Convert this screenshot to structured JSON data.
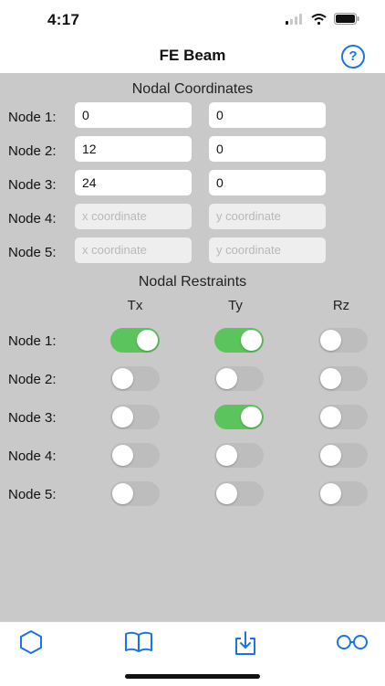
{
  "status": {
    "time": "4:17"
  },
  "nav": {
    "title": "FE Beam",
    "help": "?"
  },
  "coordinates": {
    "title": "Nodal Coordinates",
    "rows": [
      {
        "label": "Node 1:",
        "x": "0",
        "y": "0",
        "x_placeholder": "",
        "y_placeholder": ""
      },
      {
        "label": "Node 2:",
        "x": "12",
        "y": "0",
        "x_placeholder": "",
        "y_placeholder": ""
      },
      {
        "label": "Node 3:",
        "x": "24",
        "y": "0",
        "x_placeholder": "",
        "y_placeholder": ""
      },
      {
        "label": "Node 4:",
        "x": "",
        "y": "",
        "x_placeholder": "x coordinate",
        "y_placeholder": "y coordinate"
      },
      {
        "label": "Node 5:",
        "x": "",
        "y": "",
        "x_placeholder": "x coordinate",
        "y_placeholder": "y coordinate"
      }
    ]
  },
  "restraints": {
    "title": "Nodal Restraints",
    "headers": [
      "Tx",
      "Ty",
      "Rz"
    ],
    "rows": [
      {
        "label": "Node 1:",
        "tx": true,
        "ty": true,
        "rz": false
      },
      {
        "label": "Node 2:",
        "tx": false,
        "ty": false,
        "rz": false
      },
      {
        "label": "Node 3:",
        "tx": false,
        "ty": true,
        "rz": false
      },
      {
        "label": "Node 4:",
        "tx": false,
        "ty": false,
        "rz": false
      },
      {
        "label": "Node 5:",
        "tx": false,
        "ty": false,
        "rz": false
      }
    ]
  },
  "tabs": [
    {
      "icon": "hexagon-icon"
    },
    {
      "icon": "book-icon"
    },
    {
      "icon": "download-tray-icon"
    },
    {
      "icon": "glasses-icon"
    }
  ],
  "colors": {
    "accent": "#1a74e8",
    "toggle_on": "#5cc45c",
    "toggle_off": "#bdbdbd",
    "panel": "#c9c9c9"
  }
}
